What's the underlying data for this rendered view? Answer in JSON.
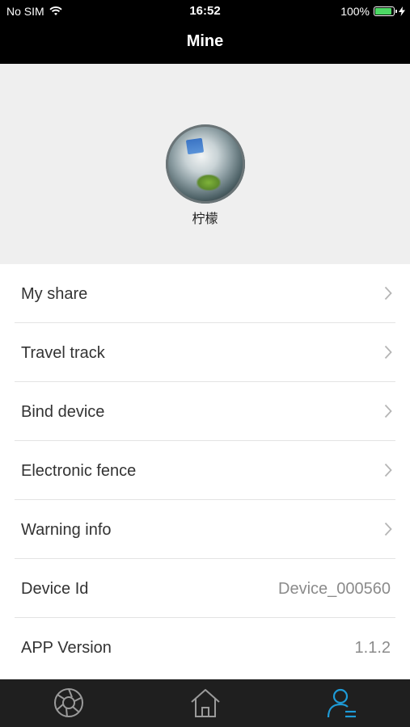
{
  "status_bar": {
    "carrier": "No SIM",
    "time": "16:52",
    "battery": "100%",
    "icons": [
      "wifi-icon",
      "battery-icon",
      "charging-bolt-icon"
    ]
  },
  "nav": {
    "title": "Mine"
  },
  "profile": {
    "name": "柠檬"
  },
  "menu": [
    {
      "label": "My share",
      "type": "link"
    },
    {
      "label": "Travel track",
      "type": "link"
    },
    {
      "label": "Bind device",
      "type": "link"
    },
    {
      "label": "Electronic fence",
      "type": "link"
    },
    {
      "label": "Warning info",
      "type": "link"
    },
    {
      "label": "Device Id",
      "type": "value",
      "value": "Device_000560"
    },
    {
      "label": "APP Version",
      "type": "value",
      "value": "1.1.2"
    }
  ],
  "tab_bar": {
    "tabs": [
      {
        "icon": "camera-shutter-icon",
        "active": false
      },
      {
        "icon": "home-icon",
        "active": false
      },
      {
        "icon": "profile-icon",
        "active": true
      }
    ],
    "active_color": "#1e9bd7",
    "inactive_color": "#9a9a9a"
  }
}
